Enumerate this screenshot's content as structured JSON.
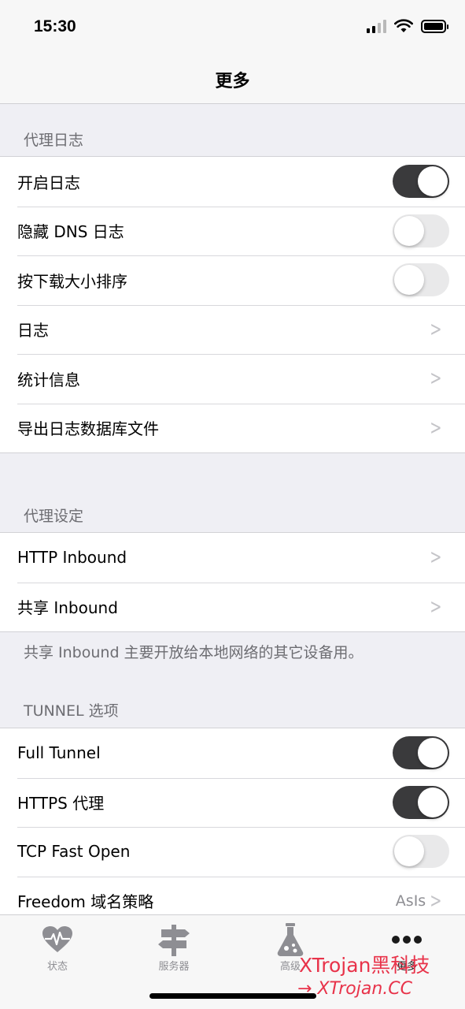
{
  "status_bar": {
    "time": "15:30"
  },
  "nav": {
    "title": "更多"
  },
  "sections": {
    "proxy_log": {
      "header": "代理日志",
      "rows": [
        {
          "label": "开启日志",
          "toggle": true
        },
        {
          "label": "隐藏 DNS 日志",
          "toggle": false
        },
        {
          "label": "按下载大小排序",
          "toggle": false
        },
        {
          "label": "日志"
        },
        {
          "label": "统计信息"
        },
        {
          "label": "导出日志数据库文件"
        }
      ]
    },
    "proxy_settings": {
      "header": "代理设定",
      "rows": [
        {
          "label": "HTTP Inbound"
        },
        {
          "label": "共享 Inbound"
        }
      ],
      "footer": "共享 Inbound 主要开放给本地网络的其它设备用。"
    },
    "tunnel": {
      "header": "TUNNEL 选项",
      "rows": [
        {
          "label": "Full Tunnel",
          "toggle": true
        },
        {
          "label": "HTTPS 代理",
          "toggle": true
        },
        {
          "label": "TCP Fast Open",
          "toggle": false
        },
        {
          "label": "Freedom 域名策略",
          "value": "AsIs"
        }
      ]
    }
  },
  "tabs": [
    {
      "label": "状态",
      "icon": "heartbeat-icon"
    },
    {
      "label": "服务器",
      "icon": "signpost-icon"
    },
    {
      "label": "高级",
      "icon": "flask-icon"
    },
    {
      "label": "更多",
      "icon": "more-dots-icon",
      "active": true
    }
  ],
  "watermark": {
    "line1": "XTrojan黑科技",
    "line2": "XTrojan.CC"
  },
  "colors": {
    "toggle_on": "#3a3a3c",
    "toggle_off": "#e9e9ea",
    "watermark": "#e8334a"
  }
}
